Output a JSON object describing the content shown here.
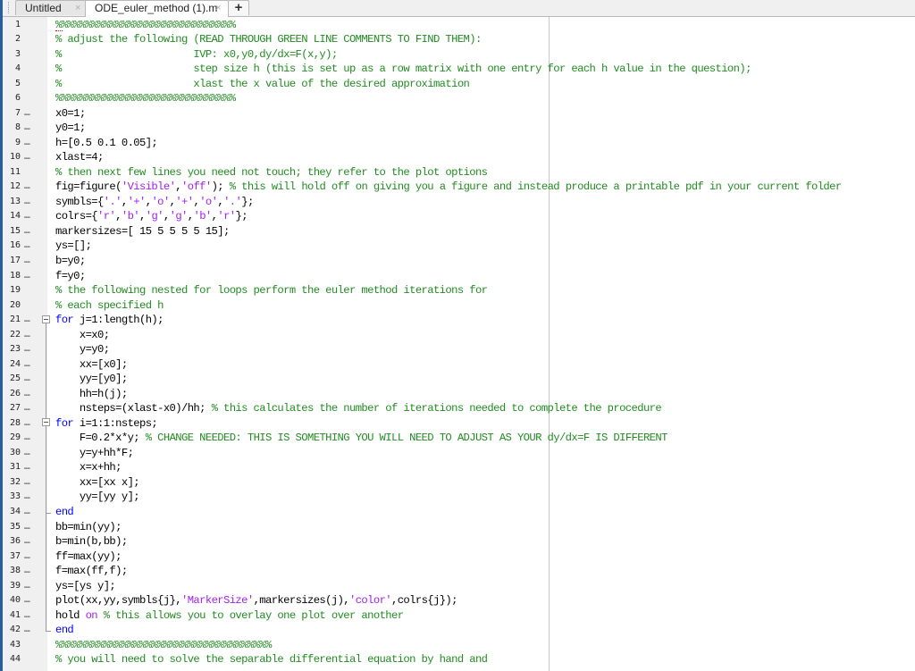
{
  "tabs": [
    {
      "label": "Untitled",
      "close_icon": "×",
      "active": false
    },
    {
      "label": "ODE_euler_method (1).m",
      "close_icon": "×",
      "active": true
    }
  ],
  "new_tab_label": "+",
  "lines": [
    {
      "n": "1",
      "exec": false,
      "parts": [
        [
          "c",
          "%%%%%%%%%%%%%%%%%%%%%%%%%%%%%%"
        ]
      ]
    },
    {
      "n": "2",
      "exec": false,
      "parts": [
        [
          "c",
          "% adjust the following (READ THROUGH GREEN LINE COMMENTS TO FIND THEM):"
        ]
      ]
    },
    {
      "n": "3",
      "exec": false,
      "parts": [
        [
          "c",
          "%                      IVP: x0,y0,dy/dx=F(x,y);"
        ]
      ]
    },
    {
      "n": "4",
      "exec": false,
      "parts": [
        [
          "c",
          "%                      step size h (this is set up as a row matrix with one entry for each h value in the question);"
        ]
      ]
    },
    {
      "n": "5",
      "exec": false,
      "parts": [
        [
          "c",
          "%                      xlast the x value of the desired approximation"
        ]
      ]
    },
    {
      "n": "6",
      "exec": false,
      "parts": [
        [
          "c",
          "%%%%%%%%%%%%%%%%%%%%%%%%%%%%%%"
        ]
      ]
    },
    {
      "n": "7",
      "exec": true,
      "parts": [
        [
          "t",
          "x0=1;"
        ]
      ]
    },
    {
      "n": "8",
      "exec": true,
      "parts": [
        [
          "t",
          "y0=1;"
        ]
      ]
    },
    {
      "n": "9",
      "exec": true,
      "parts": [
        [
          "t",
          "h=[0.5 0.1 0.05];"
        ]
      ]
    },
    {
      "n": "10",
      "exec": true,
      "parts": [
        [
          "t",
          "xlast=4;"
        ]
      ]
    },
    {
      "n": "11",
      "exec": false,
      "parts": [
        [
          "c",
          "% then next few lines you need not touch; they refer to the plot options"
        ]
      ]
    },
    {
      "n": "12",
      "exec": true,
      "parts": [
        [
          "t",
          "fig=figure("
        ],
        [
          "s",
          "'Visible'"
        ],
        [
          "t",
          ","
        ],
        [
          "s",
          "'off'"
        ],
        [
          "t",
          "); "
        ],
        [
          "c",
          "% this will hold off on giving you a figure and instead produce a printable pdf in your current folder"
        ]
      ]
    },
    {
      "n": "13",
      "exec": true,
      "parts": [
        [
          "t",
          "symbls={"
        ],
        [
          "s",
          "'.'"
        ],
        [
          "t",
          ","
        ],
        [
          "s",
          "'+'"
        ],
        [
          "t",
          ","
        ],
        [
          "s",
          "'o'"
        ],
        [
          "t",
          ","
        ],
        [
          "s",
          "'+'"
        ],
        [
          "t",
          ","
        ],
        [
          "s",
          "'o'"
        ],
        [
          "t",
          ","
        ],
        [
          "s",
          "'.'"
        ],
        [
          "t",
          "};"
        ]
      ]
    },
    {
      "n": "14",
      "exec": true,
      "parts": [
        [
          "t",
          "colrs={"
        ],
        [
          "s",
          "'r'"
        ],
        [
          "t",
          ","
        ],
        [
          "s",
          "'b'"
        ],
        [
          "t",
          ","
        ],
        [
          "s",
          "'g'"
        ],
        [
          "t",
          ","
        ],
        [
          "s",
          "'g'"
        ],
        [
          "t",
          ","
        ],
        [
          "s",
          "'b'"
        ],
        [
          "t",
          ","
        ],
        [
          "s",
          "'r'"
        ],
        [
          "t",
          "};"
        ]
      ]
    },
    {
      "n": "15",
      "exec": true,
      "parts": [
        [
          "t",
          "markersizes=[ 15 5 5 5 5 15];"
        ]
      ]
    },
    {
      "n": "16",
      "exec": true,
      "parts": [
        [
          "t",
          "ys=[];"
        ]
      ]
    },
    {
      "n": "17",
      "exec": true,
      "parts": [
        [
          "t",
          "b=y0;"
        ]
      ]
    },
    {
      "n": "18",
      "exec": true,
      "parts": [
        [
          "t",
          "f=y0;"
        ]
      ]
    },
    {
      "n": "19",
      "exec": false,
      "parts": [
        [
          "c",
          "% the following nested for loops perform the euler method iterations for"
        ]
      ]
    },
    {
      "n": "20",
      "exec": false,
      "parts": [
        [
          "c",
          "% each specified h"
        ]
      ]
    },
    {
      "n": "21",
      "exec": true,
      "parts": [
        [
          "k",
          "for"
        ],
        [
          "t",
          " j=1:length(h);"
        ]
      ]
    },
    {
      "n": "22",
      "exec": true,
      "parts": [
        [
          "t",
          "    x=x0;"
        ]
      ]
    },
    {
      "n": "23",
      "exec": true,
      "parts": [
        [
          "t",
          "    y=y0;"
        ]
      ]
    },
    {
      "n": "24",
      "exec": true,
      "parts": [
        [
          "t",
          "    xx=[x0];"
        ]
      ]
    },
    {
      "n": "25",
      "exec": true,
      "parts": [
        [
          "t",
          "    yy=[y0];"
        ]
      ]
    },
    {
      "n": "26",
      "exec": true,
      "parts": [
        [
          "t",
          "    hh=h(j);"
        ]
      ]
    },
    {
      "n": "27",
      "exec": true,
      "parts": [
        [
          "t",
          "    nsteps=(xlast-x0)/hh; "
        ],
        [
          "c",
          "% this calculates the number of iterations needed to complete the procedure"
        ]
      ]
    },
    {
      "n": "28",
      "exec": true,
      "parts": [
        [
          "k",
          "for"
        ],
        [
          "t",
          " i=1:1:nsteps;"
        ]
      ]
    },
    {
      "n": "29",
      "exec": true,
      "parts": [
        [
          "t",
          "    F=0.2*x*y; "
        ],
        [
          "c",
          "% CHANGE NEEDED: THIS IS SOMETHING YOU WILL NEED TO ADJUST AS YOUR dy/dx=F IS DIFFERENT"
        ]
      ]
    },
    {
      "n": "30",
      "exec": true,
      "parts": [
        [
          "t",
          "    y=y+hh*F;"
        ]
      ]
    },
    {
      "n": "31",
      "exec": true,
      "parts": [
        [
          "t",
          "    x=x+hh;"
        ]
      ]
    },
    {
      "n": "32",
      "exec": true,
      "parts": [
        [
          "t",
          "    xx=[xx x];"
        ]
      ]
    },
    {
      "n": "33",
      "exec": true,
      "parts": [
        [
          "t",
          "    yy=[yy y];"
        ]
      ]
    },
    {
      "n": "34",
      "exec": true,
      "parts": [
        [
          "k",
          "end"
        ]
      ]
    },
    {
      "n": "35",
      "exec": true,
      "parts": [
        [
          "t",
          "bb=min(yy);"
        ]
      ]
    },
    {
      "n": "36",
      "exec": true,
      "parts": [
        [
          "t",
          "b=min(b,bb);"
        ]
      ]
    },
    {
      "n": "37",
      "exec": true,
      "parts": [
        [
          "t",
          "ff=max(yy);"
        ]
      ]
    },
    {
      "n": "38",
      "exec": true,
      "parts": [
        [
          "t",
          "f=max(ff,f);"
        ]
      ]
    },
    {
      "n": "39",
      "exec": true,
      "parts": [
        [
          "t",
          "ys=[ys y];"
        ]
      ]
    },
    {
      "n": "40",
      "exec": true,
      "parts": [
        [
          "t",
          "plot(xx,yy,symbls{j},"
        ],
        [
          "s",
          "'MarkerSize'"
        ],
        [
          "t",
          ",markersizes(j),"
        ],
        [
          "s",
          "'color'"
        ],
        [
          "t",
          ",colrs{j});"
        ]
      ]
    },
    {
      "n": "41",
      "exec": true,
      "parts": [
        [
          "t",
          "hold "
        ],
        [
          "s",
          "on"
        ],
        [
          "t",
          " "
        ],
        [
          "c",
          "% this allows you to overlay one plot over another"
        ]
      ]
    },
    {
      "n": "42",
      "exec": true,
      "parts": [
        [
          "k",
          "end"
        ]
      ]
    },
    {
      "n": "43",
      "exec": false,
      "parts": [
        [
          "c",
          "%%%%%%%%%%%%%%%%%%%%%%%%%%%%%%%%%%%%"
        ]
      ]
    },
    {
      "n": "44",
      "exec": false,
      "parts": [
        [
          "c",
          "% you will need to solve the separable differential equation by hand and"
        ]
      ]
    }
  ],
  "exec_marker": "–",
  "colors": {
    "comment": "#228b22",
    "keyword": "#0000ff",
    "string": "#a020f0",
    "text": "#000000",
    "gutter": "#f0f0f0",
    "left_strip": "#2a5d9f"
  }
}
